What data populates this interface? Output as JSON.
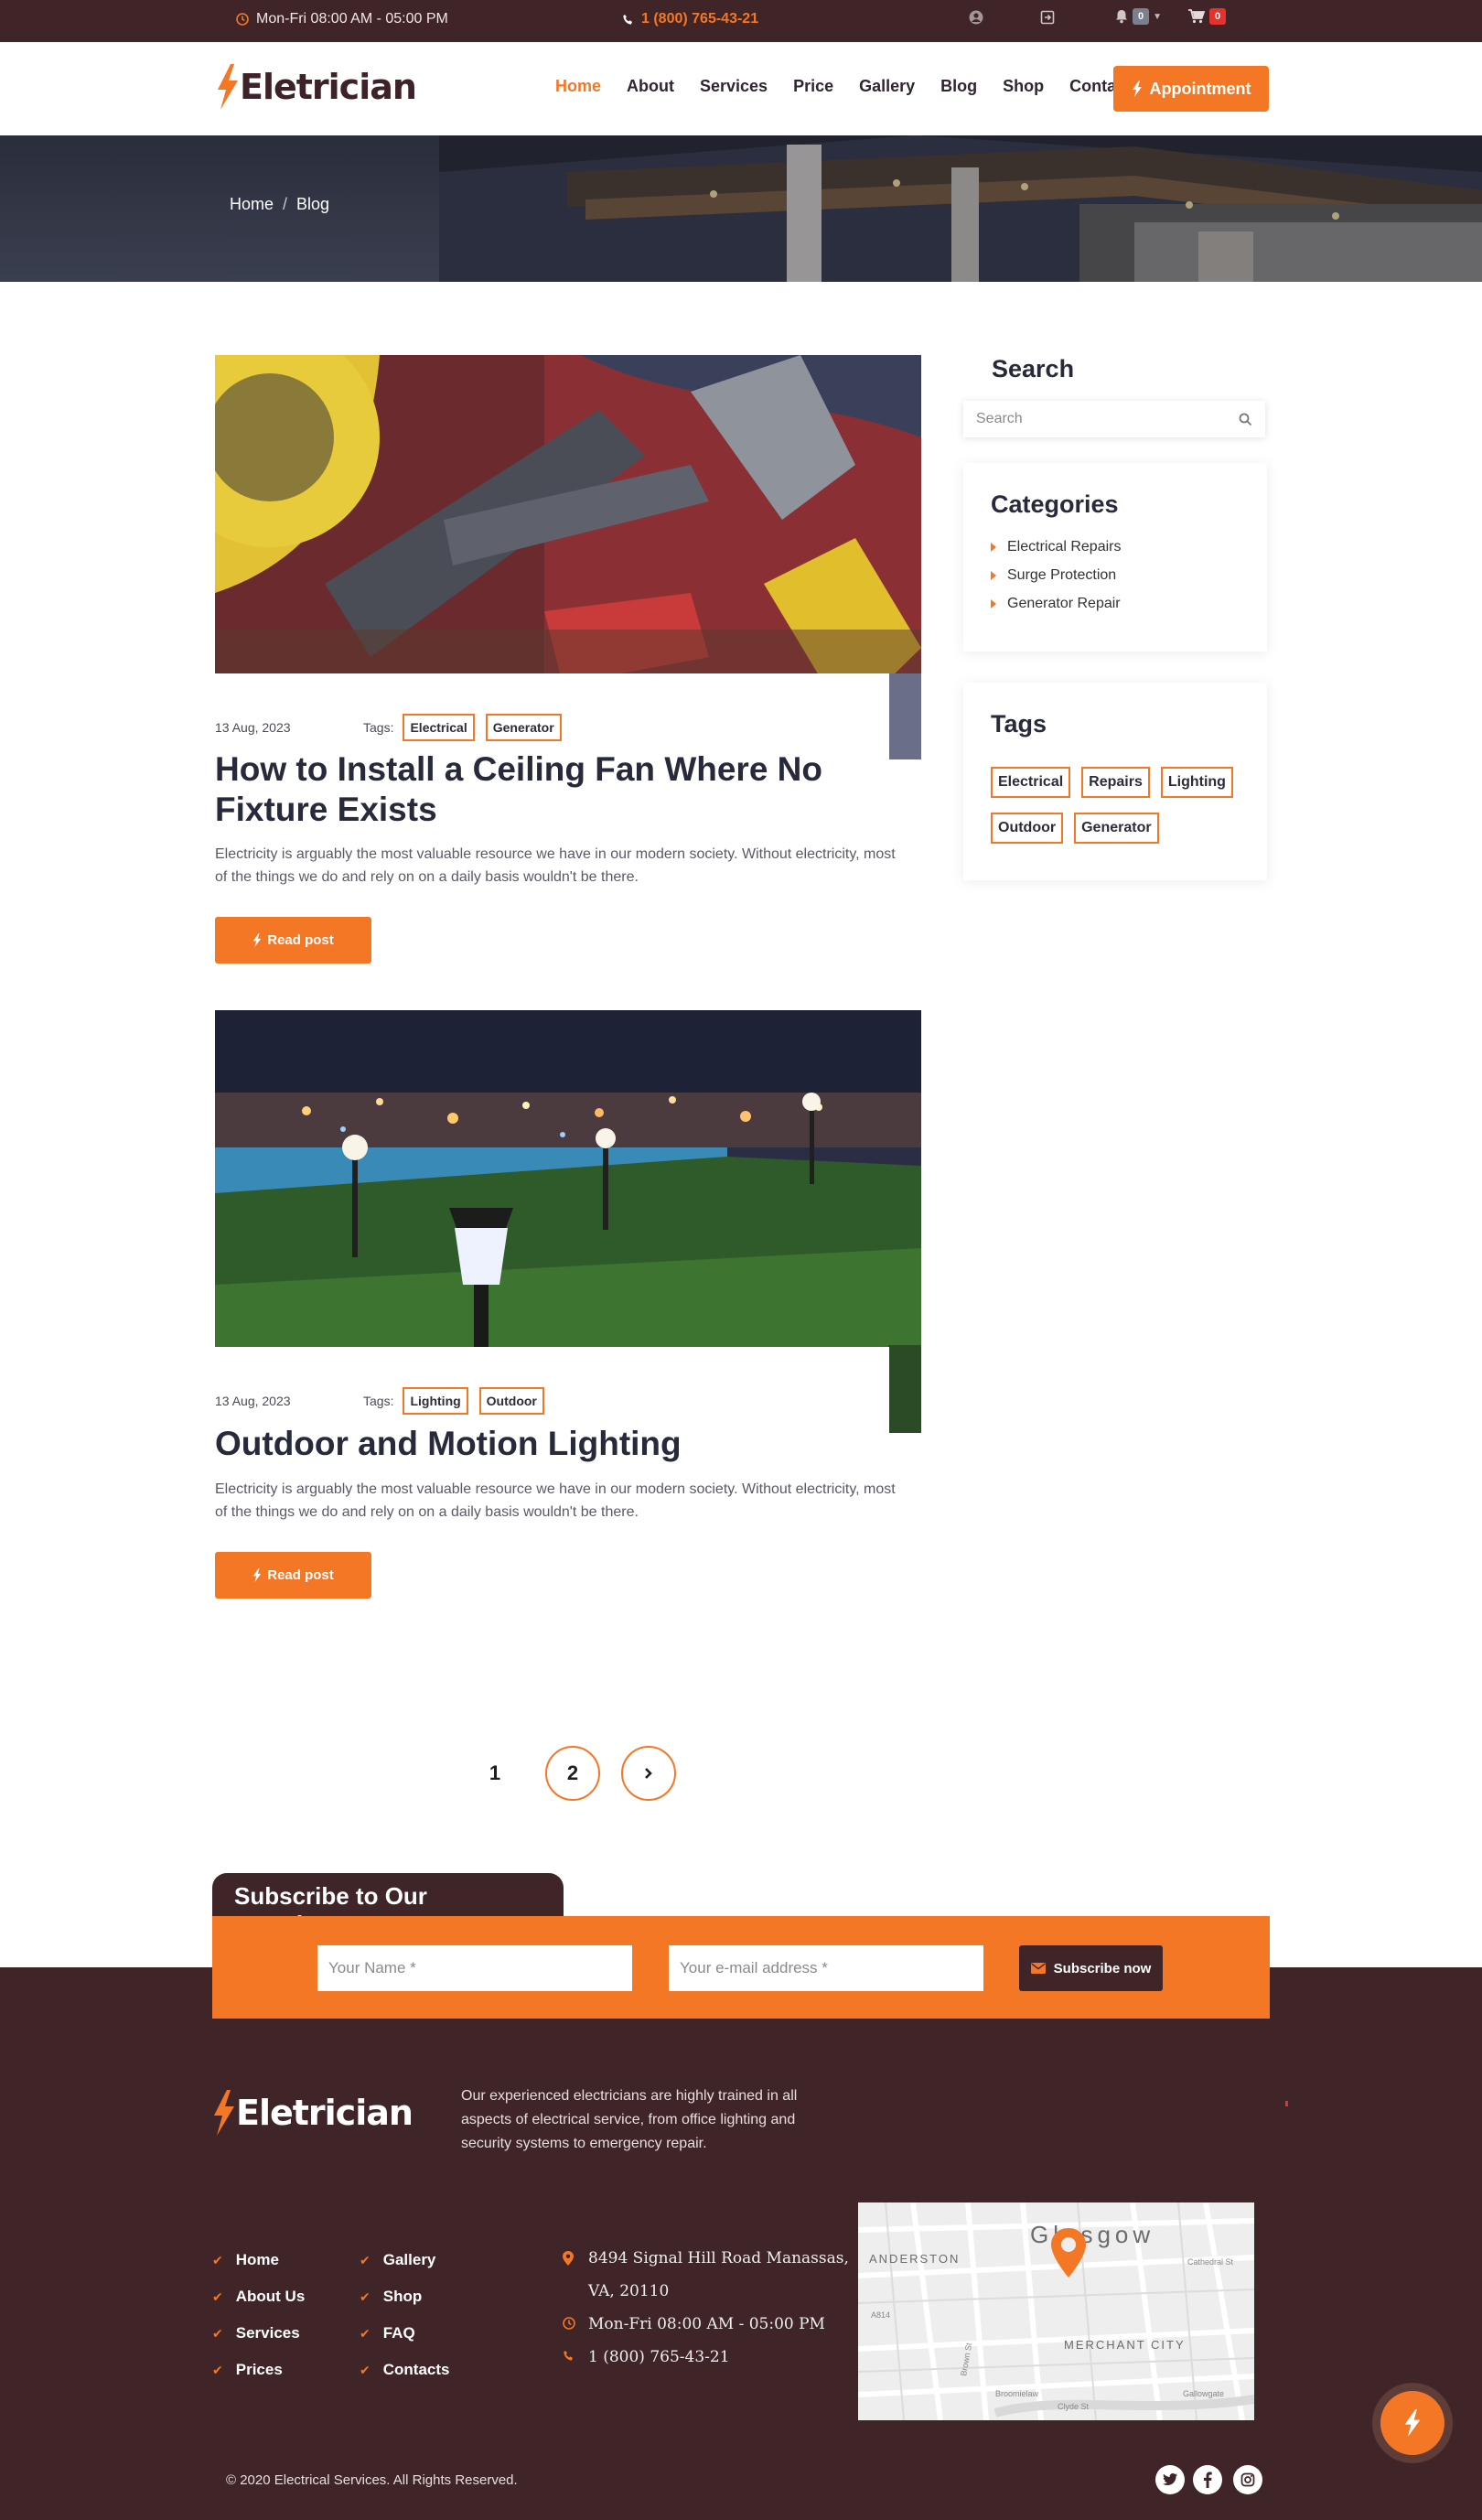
{
  "topbar": {
    "hours": "Mon-Fri 08:00 AM - 05:00 PM",
    "phone": "1 (800) 765-43-21",
    "notifications_count": "0",
    "cart_count": "0"
  },
  "header": {
    "logo_text": "Eletrician",
    "nav": [
      "Home",
      "About",
      "Services",
      "Price",
      "Gallery",
      "Blog",
      "Shop",
      "Contact"
    ],
    "active_nav": "Home",
    "appointment_label": "Appointment"
  },
  "banner": {
    "breadcrumb": [
      "Home",
      "Blog"
    ]
  },
  "posts": [
    {
      "date": "13 Aug, 2023",
      "tags_label": "Tags:",
      "tags": [
        "Electrical",
        "Generator"
      ],
      "title": "How to Install a Ceiling Fan Where No Fixture Exists",
      "excerpt": "Electricity is arguably the most valuable resource we have in our modern society. Without electricity, most of the things we do and rely on on a daily basis wouldn't be there.",
      "button": "Read post"
    },
    {
      "date": "13 Aug, 2023",
      "tags_label": "Tags:",
      "tags": [
        "Lighting",
        "Outdoor"
      ],
      "title": "Outdoor and Motion Lighting",
      "excerpt": "Electricity is arguably the most valuable resource we have in our modern society. Without electricity, most of the things we do and rely on on a daily basis wouldn't be there.",
      "button": "Read post"
    }
  ],
  "sidebar": {
    "search_title": "Search",
    "search_placeholder": "Search",
    "categories_title": "Categories",
    "categories": [
      "Electrical Repairs",
      "Surge Protection",
      "Generator Repair"
    ],
    "tags_title": "Tags",
    "tags": [
      "Electrical",
      "Repairs",
      "Lighting",
      "Outdoor",
      "Generator"
    ]
  },
  "pagination": {
    "pages": [
      "1",
      "2"
    ],
    "current": "2",
    "next": "›"
  },
  "newsletter": {
    "title": "Subscribe to Our Newsletter",
    "name_placeholder": "Your Name *",
    "email_placeholder": "Your e-mail address *",
    "button": "Subscribe now"
  },
  "footer": {
    "logo_text": "Eletrician",
    "description": "Our experienced electricians are highly trained in all aspects of electrical service, from office lighting and security systems to emergency repair.",
    "links_col1": [
      "Home",
      "About Us",
      "Services",
      "Prices"
    ],
    "links_col2": [
      "Gallery",
      "Shop",
      "FAQ",
      "Contacts"
    ],
    "address_line1": "8494 Signal Hill Road Manassas,",
    "address_line2": "VA, 20110",
    "hours": "Mon-Fri 08:00 AM - 05:00 PM",
    "phone": "1 (800) 765-43-21",
    "map_labels": {
      "city": "Glasgow",
      "district1": "ANDERSTON",
      "district2": "MERCHANT CITY",
      "street1": "Cathedral St",
      "street2": "A814",
      "street3": "Broomielaw",
      "street4": "Clyde St",
      "street5": "Gallowgate",
      "street6": "Brown St"
    },
    "copyright": "© 2020 Electrical Services. All Rights Reserved.",
    "social_icons": [
      "twitter-icon",
      "facebook-icon",
      "instagram-icon"
    ]
  },
  "colors": {
    "accent": "#f47726",
    "dark": "#3f2428",
    "heading": "#262a3b"
  }
}
